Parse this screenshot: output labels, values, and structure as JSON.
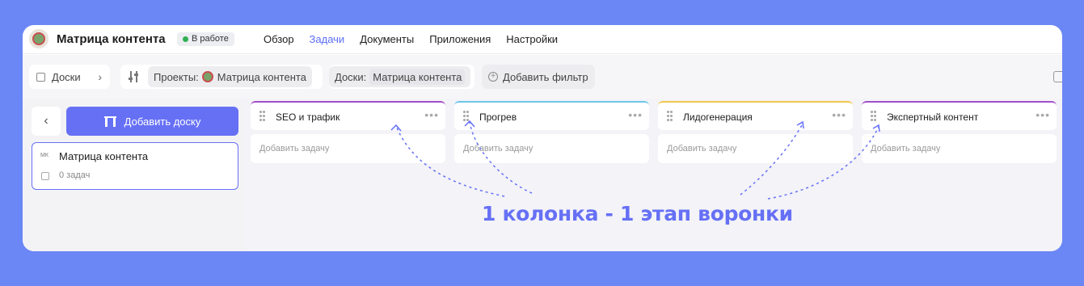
{
  "topbar": {
    "app_title": "Матрица контента",
    "status": "В работе",
    "nav": [
      {
        "label": "Обзор",
        "active": false
      },
      {
        "label": "Задачи",
        "active": true
      },
      {
        "label": "Документы",
        "active": false
      },
      {
        "label": "Приложения",
        "active": false
      },
      {
        "label": "Настройки",
        "active": false
      }
    ]
  },
  "filterbar": {
    "boards_crumb": "Доски",
    "projects_label": "Проекты:",
    "projects_value": "Матрица контента",
    "boards_label": "Доски:",
    "boards_value": "Матрица контента",
    "add_filter": "Добавить фильтр"
  },
  "sidebar": {
    "add_board": "Добавить доску",
    "board": {
      "abbr": "МК",
      "name": "Матрица контента",
      "tasks": "0 задач"
    }
  },
  "columns": [
    {
      "title": "SEO и трафик",
      "color": "#a24fc9",
      "add_task": "Добавить задачу"
    },
    {
      "title": "Прогрев",
      "color": "#6fc6e8",
      "add_task": "Добавить задачу"
    },
    {
      "title": "Лидогенерация",
      "color": "#f0c84a",
      "add_task": "Добавить задачу"
    },
    {
      "title": "Экспертный контент",
      "color": "#a24fc9",
      "add_task": "Добавить задачу"
    }
  ],
  "annotation": "1 колонка - 1 этап воронки",
  "colors": {
    "background": "#6b87f5",
    "accent": "#6670f5",
    "active_nav": "#5b6ef5",
    "status_dot": "#2fb052"
  }
}
